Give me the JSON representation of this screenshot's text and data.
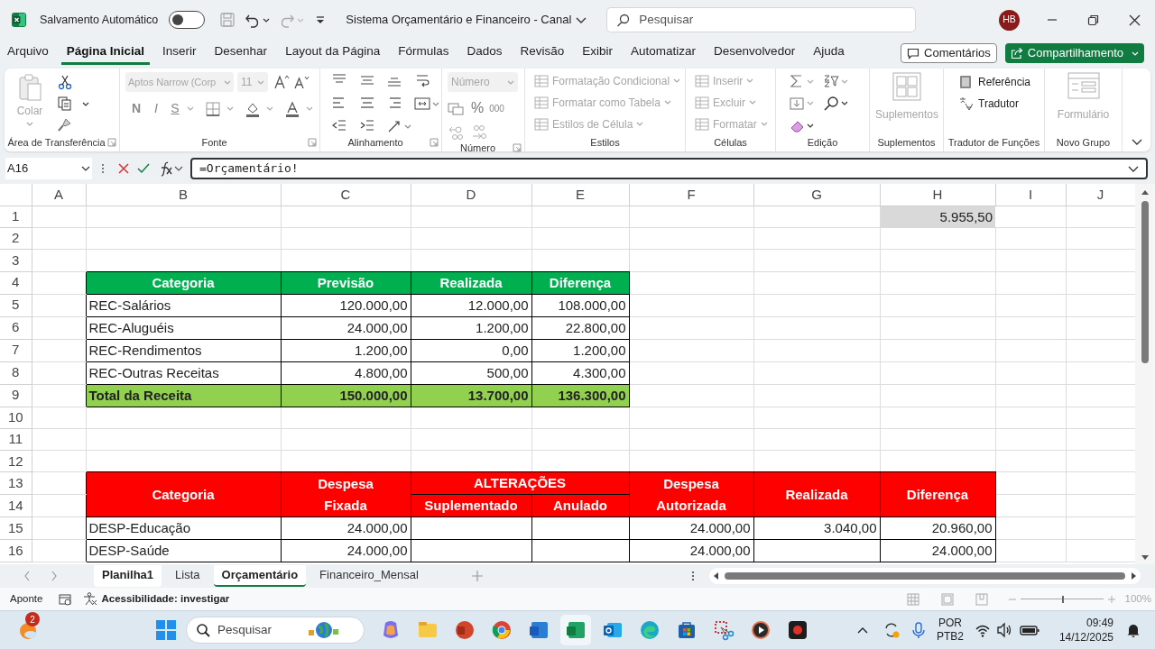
{
  "title_bar": {
    "autosave_label": "Salvamento Automático",
    "autosave_on": false,
    "document_title": "Sistema Orçamentário e Financeiro - Canal",
    "search_placeholder": "Pesquisar",
    "avatar_initials": "HB"
  },
  "menu_tabs": [
    {
      "label": "Arquivo",
      "selected": false
    },
    {
      "label": "Página Inicial",
      "selected": true
    },
    {
      "label": "Inserir",
      "selected": false
    },
    {
      "label": "Desenhar",
      "selected": false
    },
    {
      "label": "Layout da Página",
      "selected": false
    },
    {
      "label": "Fórmulas",
      "selected": false
    },
    {
      "label": "Dados",
      "selected": false
    },
    {
      "label": "Revisão",
      "selected": false
    },
    {
      "label": "Exibir",
      "selected": false
    },
    {
      "label": "Automatizar",
      "selected": false
    },
    {
      "label": "Desenvolvedor",
      "selected": false
    },
    {
      "label": "Ajuda",
      "selected": false
    }
  ],
  "comments_button": "Comentários",
  "share_button": "Compartilhamento",
  "ribbon": {
    "clipboard": {
      "label": "Área de Transferência",
      "paste": "Colar",
      "paste_disabled": true
    },
    "font": {
      "label": "Fonte",
      "font_name": "Aptos Narrow (Corp",
      "font_size": "11",
      "bold": "N",
      "italic": "I",
      "underline": "S",
      "disabled": true
    },
    "alignment": {
      "label": "Alinhamento"
    },
    "number": {
      "label": "Número",
      "format": "Número",
      "percent": "%",
      "thousands": "000",
      "disabled": true
    },
    "styles": {
      "label": "Estilos",
      "items": [
        "Formatação Condicional",
        "Formatar como Tabela",
        "Estilos de Célula"
      ],
      "disabled": true
    },
    "cells": {
      "label": "Células",
      "items": [
        "Inserir",
        "Excluir",
        "Formatar"
      ],
      "disabled": true
    },
    "editing": {
      "label": "Edição"
    },
    "addins": {
      "label": "Suplementos",
      "button": "Suplementos",
      "disabled": true
    },
    "translator": {
      "label": "Tradutor de Funções",
      "items": [
        "Referência",
        "Tradutor"
      ]
    },
    "new_group": {
      "label": "Novo Grupo",
      "button": "Formulário",
      "disabled": true
    }
  },
  "formula_bar": {
    "name_box": "A16",
    "formula": "=Orçamentário!"
  },
  "sheet": {
    "columns": [
      "A",
      "B",
      "C",
      "D",
      "E",
      "F",
      "G",
      "H",
      "I",
      "J"
    ],
    "rows": [
      "1",
      "2",
      "3",
      "4",
      "5",
      "6",
      "7",
      "8",
      "9",
      "10",
      "11",
      "12",
      "13",
      "14",
      "15",
      "16"
    ],
    "h1_value": "5.955,50",
    "revenue_table": {
      "headers": [
        "Categoria",
        "Previsão",
        "Realizada",
        "Diferença"
      ],
      "rows": [
        [
          "REC-Salários",
          "120.000,00",
          "12.000,00",
          "108.000,00"
        ],
        [
          "REC-Aluguéis",
          "24.000,00",
          "1.200,00",
          "22.800,00"
        ],
        [
          "REC-Rendimentos",
          "1.200,00",
          "0,00",
          "1.200,00"
        ],
        [
          "REC-Outras Receitas",
          "4.800,00",
          "500,00",
          "4.300,00"
        ]
      ],
      "total": [
        "Total da Receita",
        "150.000,00",
        "13.700,00",
        "136.300,00"
      ]
    },
    "expense_table": {
      "category_header": "Categoria",
      "fixed_header": "Despesa\nFixada",
      "changes_header": "ALTERAÇÕES",
      "supplemented_header": "Suplementado",
      "annulled_header": "Anulado",
      "authorized_header": "Despesa\nAutorizada",
      "realized_header": "Realizada",
      "difference_header": "Diferença",
      "rows": [
        {
          "category": "DESP-Educação",
          "fixed": "24.000,00",
          "authorized": "24.000,00",
          "realized": "3.040,00",
          "difference": "20.960,00"
        },
        {
          "category": "DESP-Saúde",
          "fixed": "24.000,00",
          "authorized": "24.000,00",
          "difference": "24.000,00"
        }
      ]
    }
  },
  "sheet_tabs": [
    {
      "label": "Planilha1",
      "selected": true,
      "active": false
    },
    {
      "label": "Lista",
      "selected": false,
      "active": false
    },
    {
      "label": "Orçamentário",
      "selected": true,
      "active": true
    },
    {
      "label": "Financeiro_Mensal",
      "selected": false,
      "active": false
    }
  ],
  "status_bar": {
    "mode": "Aponte",
    "accessibility": "Acessibilidade: investigar",
    "zoom": "100%",
    "zoom_slider": {
      "level": 0.5
    }
  },
  "taskbar": {
    "weather_badge": "2",
    "search_placeholder": "Pesquisar",
    "language": "POR",
    "layout": "PTB2",
    "time": "09:49",
    "date": "14/12/2025"
  }
}
